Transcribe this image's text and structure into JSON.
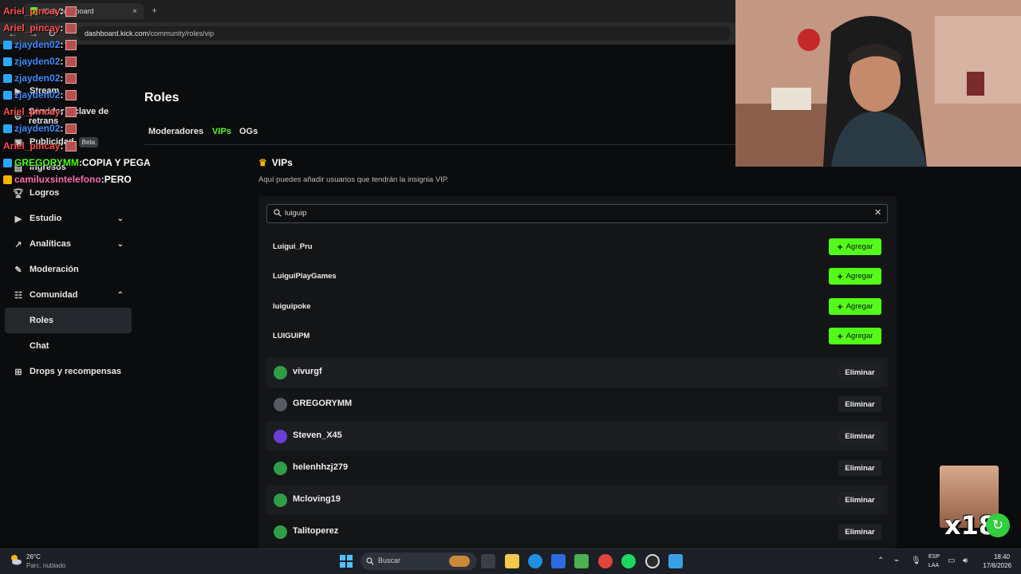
{
  "browser": {
    "tab_title": "Kick Dashboard",
    "url_host": "dashboard.kick.com",
    "url_path": "/community/roles/vip",
    "new_tab": "+",
    "close_tab": "×"
  },
  "sidebar": {
    "items": [
      {
        "label": "Stream"
      },
      {
        "label": "Servidor y clave de retrans"
      },
      {
        "label": "Publicidad",
        "badge": "Beta"
      },
      {
        "label": "Ingresos"
      },
      {
        "label": "Logros"
      },
      {
        "label": "Estudio"
      },
      {
        "label": "Analíticas"
      },
      {
        "label": "Moderación"
      },
      {
        "label": "Comunidad"
      },
      {
        "label": "Roles"
      },
      {
        "label": "Chat"
      },
      {
        "label": "Drops y recompensas"
      }
    ]
  },
  "main": {
    "title": "Roles",
    "tabs": [
      {
        "label": "Moderadores"
      },
      {
        "label": "VIPs"
      },
      {
        "label": "OGs"
      }
    ],
    "section_title": "VIPs",
    "section_desc": "Aquí puedes añadir usuarios que tendrán la insignia VIP.",
    "search_value": "luiguip",
    "search_results": [
      {
        "name": "Luigui_Pru"
      },
      {
        "name": "LuiguiPlayGames"
      },
      {
        "name": "luiguipoke"
      },
      {
        "name": "LUIGUIPM"
      }
    ],
    "add_label": "Agregar",
    "remove_label": "Eliminar",
    "vips": [
      {
        "name": "vivurgf"
      },
      {
        "name": "GREGORYMM"
      },
      {
        "name": "Steven_X45"
      },
      {
        "name": "helenhhzj279"
      },
      {
        "name": "Mcloving19"
      },
      {
        "name": "Talitoperez"
      }
    ]
  },
  "chat": [
    {
      "user": "Ariel_pincay",
      "sep": " :",
      "msg": ""
    },
    {
      "user": "Ariel_pincay",
      "sep": " :",
      "msg": ""
    },
    {
      "user": "zjayden02",
      "sep": " :",
      "msg": ""
    },
    {
      "user": "zjayden02",
      "sep": " :",
      "msg": ""
    },
    {
      "user": "zjayden02",
      "sep": " :",
      "msg": ""
    },
    {
      "user": "zjayden02",
      "sep": " :",
      "msg": ""
    },
    {
      "user": "Ariel_pincay",
      "sep": " :",
      "msg": ""
    },
    {
      "user": "zjayden02",
      "sep": " :",
      "msg": ""
    },
    {
      "user": "Ariel_pincay",
      "sep": " :",
      "msg": ""
    },
    {
      "user": "GREGORYMM",
      "sep": " :",
      "msg": " COPIA Y PEGA"
    },
    {
      "user": "camiluxsintelefono",
      "sep": " :",
      "msg": " PERO"
    }
  ],
  "overlay": {
    "counter": "x18"
  },
  "taskbar": {
    "weather_temp": "26°C",
    "weather_desc": "Parc. nublado",
    "search_placeholder": "Buscar",
    "lang1": "ESP",
    "lang2": "LAA",
    "time": "18:40",
    "date": "17/8/2026"
  },
  "colors": {
    "accent": "#53fc18",
    "chat_red": "#ff4d4d",
    "chat_blue": "#3f8cff",
    "chat_green": "#53fc18",
    "chat_pink": "#ff6fb5"
  }
}
